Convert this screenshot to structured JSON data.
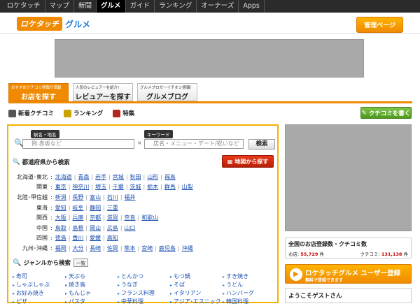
{
  "topnav": [
    "ロケタッチ",
    "マップ",
    "新聞",
    "グルメ",
    "ガイド",
    "ランキング",
    "オーナーズ",
    "Apps"
  ],
  "logo": {
    "mark": "ロケタッチ",
    "sub": "グルメ"
  },
  "admin_button": "管理ページ",
  "tabs": [
    {
      "sub": "おすすめクチコミ情報が満載",
      "main": "お店を探す"
    },
    {
      "sub": "人気のレビュアーを紹介!",
      "main": "レビュアーを探す"
    },
    {
      "sub": "グルメブロガーイチオシ情報!",
      "main": "グルメブログ"
    }
  ],
  "subnav": [
    "新着クチコミ",
    "ランキング",
    "特集"
  ],
  "kuchikomi_button": "クチコミを書く",
  "search": {
    "label_area": "駅名・地名",
    "placeholder_area": "例:赤坂など",
    "label_keyword": "キーワード",
    "placeholder_keyword": "店名・メニュー・デート/祝いなど",
    "button": "検索"
  },
  "pref_title": "都道府県から検索",
  "map_button": "地図から探す",
  "regions": [
    {
      "name": "北海道･東北",
      "prefs": [
        "北海道",
        "青森",
        "岩手",
        "宮城",
        "秋田",
        "山形",
        "福島"
      ]
    },
    {
      "name": "関東",
      "prefs": [
        "東京",
        "神奈川",
        "埼玉",
        "千葉",
        "茨城",
        "栃木",
        "群馬",
        "山梨"
      ]
    },
    {
      "name": "北陸･甲信越",
      "prefs": [
        "新潟",
        "長野",
        "富山",
        "石川",
        "福井"
      ]
    },
    {
      "name": "東海",
      "prefs": [
        "愛知",
        "岐阜",
        "静岡",
        "三重"
      ]
    },
    {
      "name": "関西",
      "prefs": [
        "大阪",
        "兵庫",
        "京都",
        "滋賀",
        "奈良",
        "和歌山"
      ]
    },
    {
      "name": "中国",
      "prefs": [
        "鳥取",
        "島根",
        "岡山",
        "広島",
        "山口"
      ]
    },
    {
      "name": "四国",
      "prefs": [
        "徳島",
        "香川",
        "愛媛",
        "高知"
      ]
    },
    {
      "name": "九州･沖縄",
      "prefs": [
        "福岡",
        "大分",
        "長崎",
        "佐賀",
        "熊本",
        "宮崎",
        "鹿児島",
        "沖縄"
      ]
    }
  ],
  "genre_title": "ジャンルから検索",
  "genre_list_button": "一覧",
  "genres": [
    "寿司",
    "天ぷら",
    "とんかつ",
    "もつ鍋",
    "すき焼き",
    "しゃぶしゃぶ",
    "焼き鳥",
    "うなぎ",
    "そば",
    "うどん",
    "お好み焼き",
    "もんじゃ",
    "フランス料理",
    "イタリアン",
    "ハンバーグ",
    "ピザ",
    "パスタ",
    "中華料理",
    "アジア･エスニック",
    "韓国料理"
  ],
  "stats": {
    "title": "全国のお店登録数・クチコミ数",
    "shops_label": "お店:",
    "shops": "55,729",
    "shops_unit": "件",
    "reviews_label": "クチコミ:",
    "reviews": "131,138",
    "reviews_unit": "件"
  },
  "register": {
    "main": "ロケタッチグルメ ユーザー登録",
    "sub": "無料で登録できます"
  },
  "welcome": "ようこそゲストさん"
}
